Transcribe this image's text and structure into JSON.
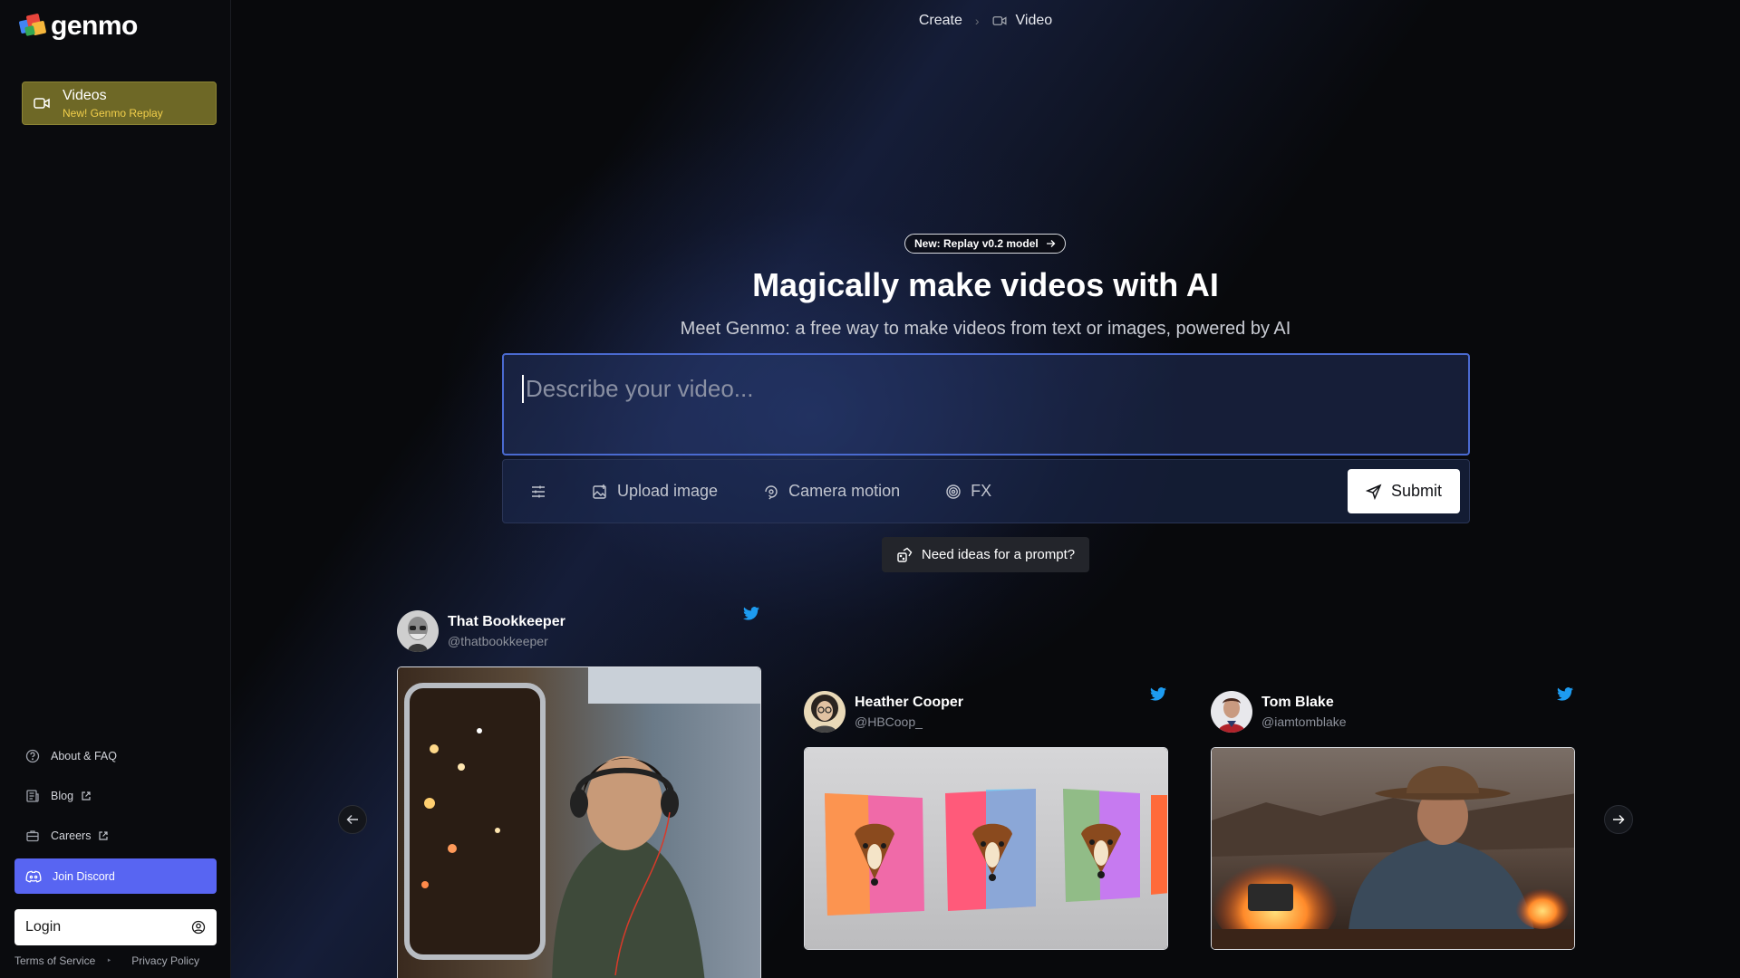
{
  "app": {
    "logo_text": "genmo",
    "brand_colors": [
      "#e8453c",
      "#f6b73c",
      "#4285f4",
      "#34a853"
    ]
  },
  "sidebar": {
    "videos": {
      "label": "Videos",
      "sublabel": "New! Genmo Replay",
      "icon": "video-camera-icon"
    },
    "links": [
      {
        "label": "About & FAQ",
        "icon": "help-circle-icon"
      },
      {
        "label": "Blog",
        "icon": "newspaper-icon",
        "external": true
      },
      {
        "label": "Careers",
        "icon": "briefcase-icon",
        "external": true
      }
    ],
    "discord": {
      "label": "Join Discord",
      "icon": "discord-icon",
      "color": "#5865f2"
    },
    "login": {
      "label": "Login",
      "icon": "user-circle-icon"
    },
    "footer": {
      "terms": "Terms of Service",
      "privacy": "Privacy Policy"
    }
  },
  "breadcrumb": {
    "root": "Create",
    "current": "Video"
  },
  "hero": {
    "badge": "New: Replay v0.2 model",
    "title": "Magically make videos with AI",
    "subtitle": "Meet Genmo: a free way to make videos from text or images, powered by AI"
  },
  "prompt": {
    "placeholder": "Describe your video...",
    "value": ""
  },
  "toolbar": {
    "upload_label": "Upload image",
    "camera_label": "Camera motion",
    "fx_label": "FX",
    "submit_label": "Submit"
  },
  "ideas": {
    "label": "Need ideas for a prompt?"
  },
  "cards": [
    {
      "name": "That Bookkeeper",
      "handle": "@thatbookkeeper",
      "source": "twitter"
    },
    {
      "name": "Heather Cooper",
      "handle": "@HBCoop_",
      "source": "twitter"
    },
    {
      "name": "Tom Blake",
      "handle": "@iamtomblake",
      "source": "twitter"
    }
  ]
}
